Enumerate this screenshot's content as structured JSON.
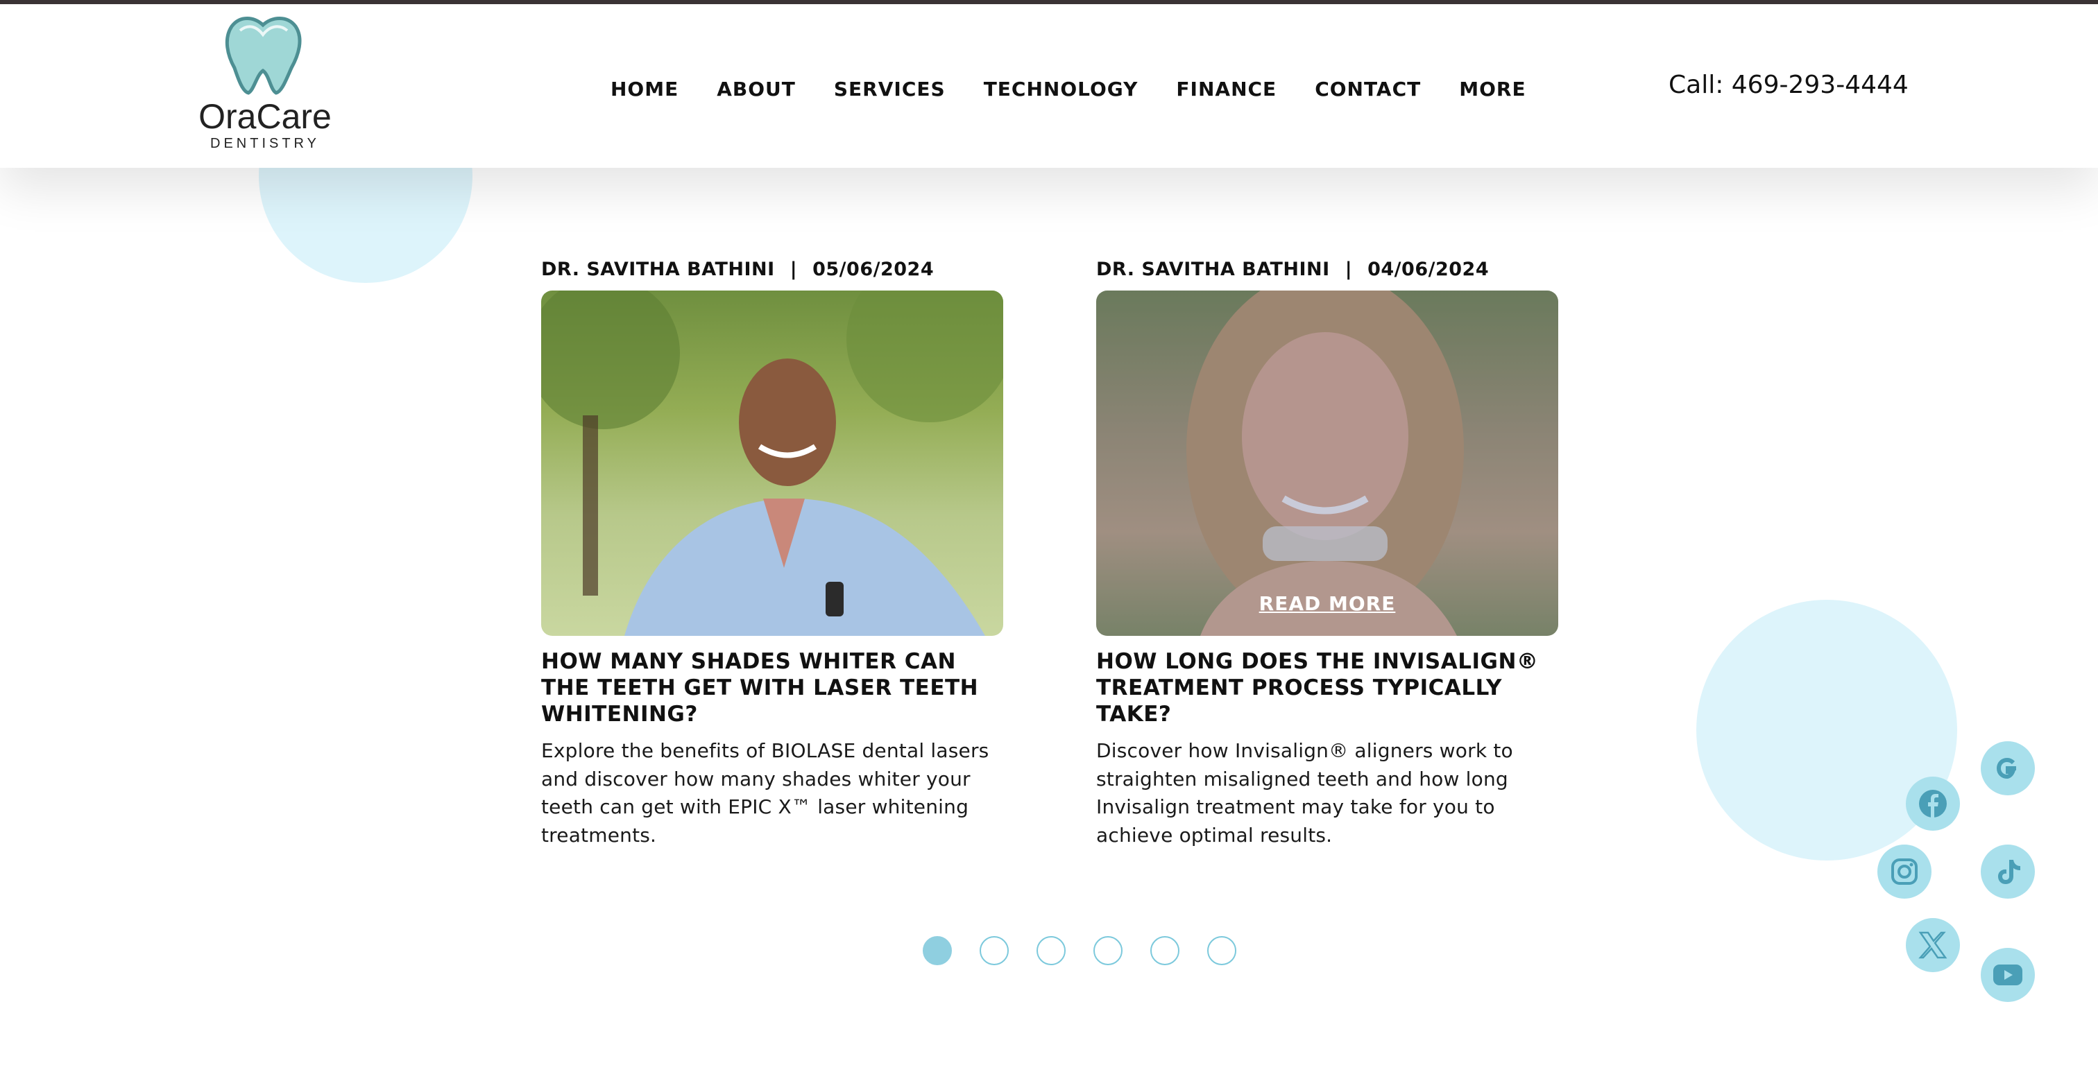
{
  "brand": {
    "name": "OraCare",
    "subtitle": "DENTISTRY",
    "accent_color": "#8fcfe0",
    "circle_color": "#ddf4fb"
  },
  "nav": {
    "items": [
      {
        "label": "HOME"
      },
      {
        "label": "ABOUT"
      },
      {
        "label": "SERVICES"
      },
      {
        "label": "TECHNOLOGY"
      },
      {
        "label": "FINANCE"
      },
      {
        "label": "CONTACT"
      },
      {
        "label": "MORE"
      }
    ]
  },
  "phone": {
    "label": "Call: 469-293-4444"
  },
  "posts": [
    {
      "author": "DR. SAVITHA BATHINI",
      "separator": "|",
      "date": "05/06/2024",
      "image_alt": "Smiling man in denim shirt outdoors",
      "title": "HOW MANY SHADES WHITER CAN THE TEETH GET WITH LASER TEETH WHITENING?",
      "excerpt": "Explore the benefits of BIOLASE dental lasers and discover how many shades whiter your teeth can get with EPIC X™ laser whitening treatments."
    },
    {
      "author": "DR. SAVITHA BATHINI",
      "separator": "|",
      "date": "04/06/2024",
      "image_alt": "Smiling woman holding clear aligner",
      "read_more": "READ MORE",
      "title": "HOW LONG DOES THE INVISALIGN® TREATMENT PROCESS TYPICALLY TAKE?",
      "excerpt": "Discover how Invisalign® aligners work to straighten misaligned teeth and how long Invisalign treatment may take for you to achieve optimal results."
    }
  ],
  "carousel": {
    "page_count": 6,
    "active_index": 0
  },
  "social": [
    {
      "icon": "google-icon"
    },
    {
      "icon": "facebook-icon"
    },
    {
      "icon": "instagram-icon"
    },
    {
      "icon": "tiktok-icon"
    },
    {
      "icon": "x-twitter-icon"
    },
    {
      "icon": "youtube-icon"
    }
  ]
}
